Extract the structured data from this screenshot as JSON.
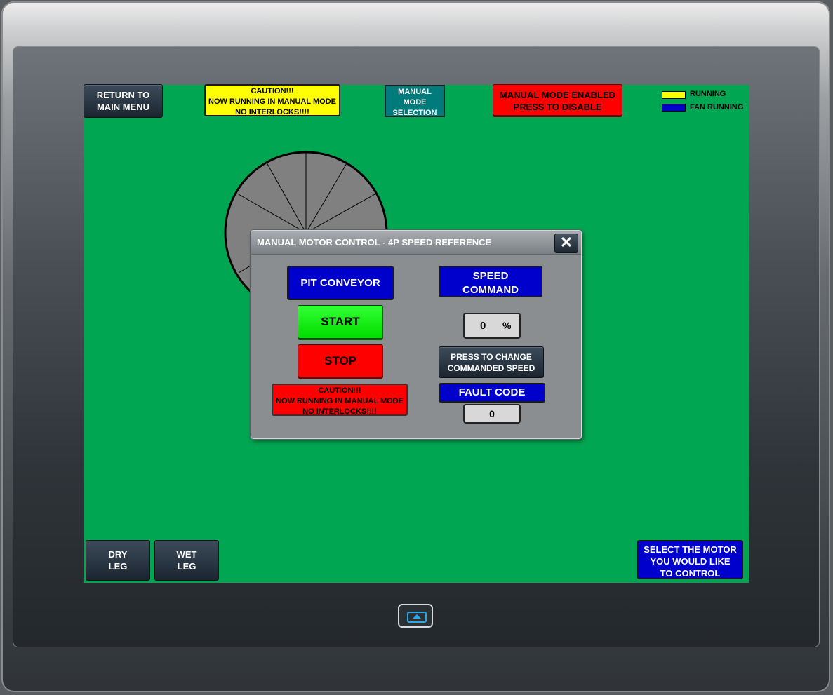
{
  "header": {
    "return_button": "RETURN TO\nMAIN MENU",
    "caution_banner": "CAUTION!!!\nNOW RUNNING IN MANUAL MODE\nNO INTERLOCKS!!!!",
    "manual_mode_selection": "MANUAL\nMODE\nSELECTION",
    "manual_mode_toggle": "MANUAL MODE ENABLED\nPRESS TO DISABLE"
  },
  "legend": {
    "items": [
      {
        "label": "RUNNING",
        "color": "#ffff00"
      },
      {
        "label": "FAN RUNNING",
        "color": "#0000cc"
      }
    ]
  },
  "dialog": {
    "title": "MANUAL MOTOR CONTROL - 4P SPEED REFERENCE",
    "close_icon": "close-icon",
    "motor_name": "PIT CONVEYOR",
    "start_label": "START",
    "stop_label": "STOP",
    "caution_text": "CAUTION!!!\nNOW RUNNING IN MANUAL MODE\nNO INTERLOCKS!!!!",
    "speed_command_label": "SPEED\nCOMMAND",
    "speed_value": "0",
    "speed_unit": "%",
    "change_speed_button": "PRESS TO CHANGE\nCOMMANDED SPEED",
    "fault_code_label": "FAULT CODE",
    "fault_code_value": "0"
  },
  "footer": {
    "dry_leg": "DRY\nLEG",
    "wet_leg": "WET\nLEG",
    "select_motor_hint": "SELECT THE MOTOR\nYOU WOULD LIKE\nTO CONTROL"
  },
  "device": {
    "home_icon": "home-arrow-icon"
  },
  "colors": {
    "screen_background": "#00a651",
    "wheel_fill": "#808080"
  }
}
